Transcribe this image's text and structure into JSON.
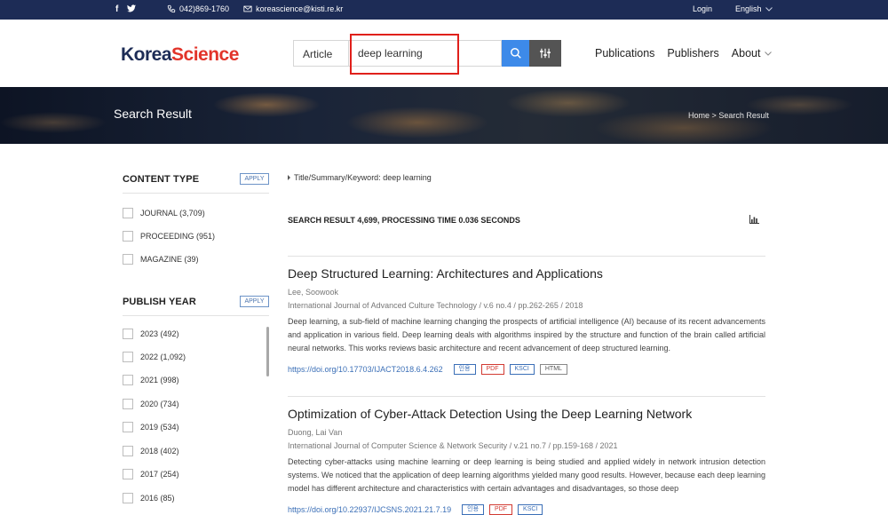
{
  "topbar": {
    "facebook": "f",
    "twitter": "t",
    "phone": "042)869-1760",
    "email": "koreascience@kisti.re.kr",
    "login": "Login",
    "language": "English"
  },
  "header": {
    "logo_part1": "Korea",
    "logo_part2": "Science",
    "search_type": "Article",
    "search_value": "deep learning",
    "nav": [
      "Publications",
      "Publishers",
      "About"
    ]
  },
  "banner": {
    "title": "Search Result",
    "breadcrumb_home": "Home",
    "breadcrumb_sep": ">",
    "breadcrumb_current": "Search Result"
  },
  "sidebar": {
    "content_type": {
      "label": "CONTENT TYPE",
      "apply": "APPLY",
      "options": [
        "JOURNAL (3,709)",
        "PROCEEDING (951)",
        "MAGAZINE (39)"
      ]
    },
    "publish_year": {
      "label": "PUBLISH YEAR",
      "apply": "APPLY",
      "options": [
        "2023 (492)",
        "2022 (1,092)",
        "2021 (998)",
        "2020 (734)",
        "2019 (534)",
        "2018 (402)",
        "2017 (254)",
        "2016 (85)"
      ]
    }
  },
  "main": {
    "query": "Title/Summary/Keyword: deep learning",
    "summary": "SEARCH RESULT 4,699, PROCESSING TIME 0.036 SECONDS",
    "results": [
      {
        "title": "Deep Structured Learning: Architectures and Applications",
        "author": "Lee, Soowook",
        "journal": "International Journal of Advanced Culture Technology  /  v.6 no.4  /  pp.262-265  /  2018",
        "abstract": "Deep learning, a sub-field of machine learning changing the prospects of artificial intelligence (AI) because of its recent advancements and application in various field. Deep learning deals with algorithms inspired by the structure and function of the brain called artificial neural networks. This works reviews basic architecture and recent advancement of deep structured learning.",
        "doi": "https://doi.org/10.17703/IJACT2018.6.4.262",
        "tags": [
          "인용",
          "PDF",
          "KSCI",
          "HTML"
        ]
      },
      {
        "title": "Optimization of Cyber-Attack Detection Using the Deep Learning Network",
        "author": "Duong, Lai Van",
        "journal": "International Journal of Computer Science & Network Security  /  v.21 no.7  /  pp.159-168  /  2021",
        "abstract": "Detecting cyber-attacks using machine learning or deep learning is being studied and applied widely in network intrusion detection systems. We noticed that the application of deep learning algorithms yielded many good results. However, because each deep learning model has different architecture and characteristics with certain advantages and disadvantages, so those deep",
        "doi": "https://doi.org/10.22937/IJCSNS.2021.21.7.19",
        "tags": [
          "인용",
          "PDF",
          "KSCI"
        ]
      }
    ]
  },
  "colors": {
    "topbar_bg": "#1d2c56",
    "logo_korea": "#1d2c56",
    "logo_science": "#e2342a",
    "search_button": "#3d8ae9",
    "filter_button": "#545454",
    "highlight": "#e0201b"
  },
  "icons": {
    "phone": "phone-icon",
    "email": "mail-icon",
    "search": "search-icon",
    "filter": "sliders-icon",
    "chart": "bar-chart-icon"
  }
}
